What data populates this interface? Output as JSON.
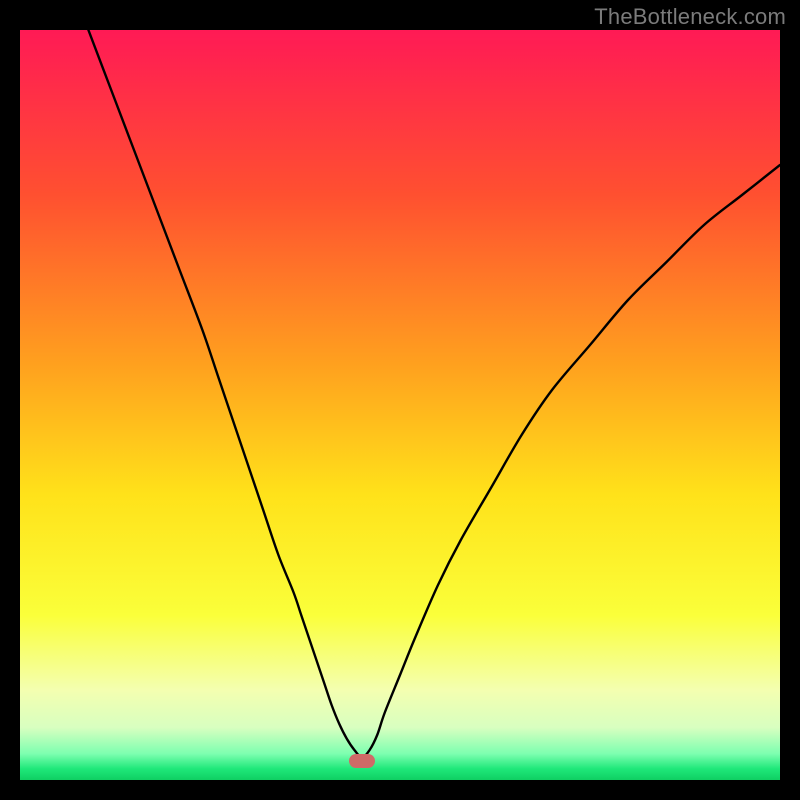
{
  "watermark": "TheBottleneck.com",
  "chart_data": {
    "type": "line",
    "title": "",
    "xlabel": "",
    "ylabel": "",
    "xlim": [
      0,
      100
    ],
    "ylim": [
      0,
      100
    ],
    "grid": false,
    "series": [
      {
        "name": "bottleneck-curve",
        "x": [
          9,
          12,
          15,
          18,
          21,
          24,
          26,
          28,
          30,
          32,
          34,
          36,
          37,
          38,
          39,
          40,
          41,
          42,
          43,
          44,
          45,
          46,
          47,
          48,
          50,
          52,
          55,
          58,
          62,
          66,
          70,
          75,
          80,
          85,
          90,
          95,
          100
        ],
        "values": [
          100,
          92,
          84,
          76,
          68,
          60,
          54,
          48,
          42,
          36,
          30,
          25,
          22,
          19,
          16,
          13,
          10,
          7.5,
          5.5,
          4,
          3,
          4,
          6,
          9,
          14,
          19,
          26,
          32,
          39,
          46,
          52,
          58,
          64,
          69,
          74,
          78,
          82
        ]
      }
    ],
    "minimum_marker": {
      "x": 45,
      "y": 2.5
    },
    "gradient_stops": [
      {
        "offset": 0.0,
        "color": "#ff1a55"
      },
      {
        "offset": 0.22,
        "color": "#ff5030"
      },
      {
        "offset": 0.45,
        "color": "#ffa21e"
      },
      {
        "offset": 0.62,
        "color": "#ffe21a"
      },
      {
        "offset": 0.78,
        "color": "#faff3a"
      },
      {
        "offset": 0.88,
        "color": "#f4ffb0"
      },
      {
        "offset": 0.93,
        "color": "#d8ffc0"
      },
      {
        "offset": 0.965,
        "color": "#7dffb0"
      },
      {
        "offset": 0.985,
        "color": "#1fe87a"
      },
      {
        "offset": 1.0,
        "color": "#0fcf62"
      }
    ]
  }
}
